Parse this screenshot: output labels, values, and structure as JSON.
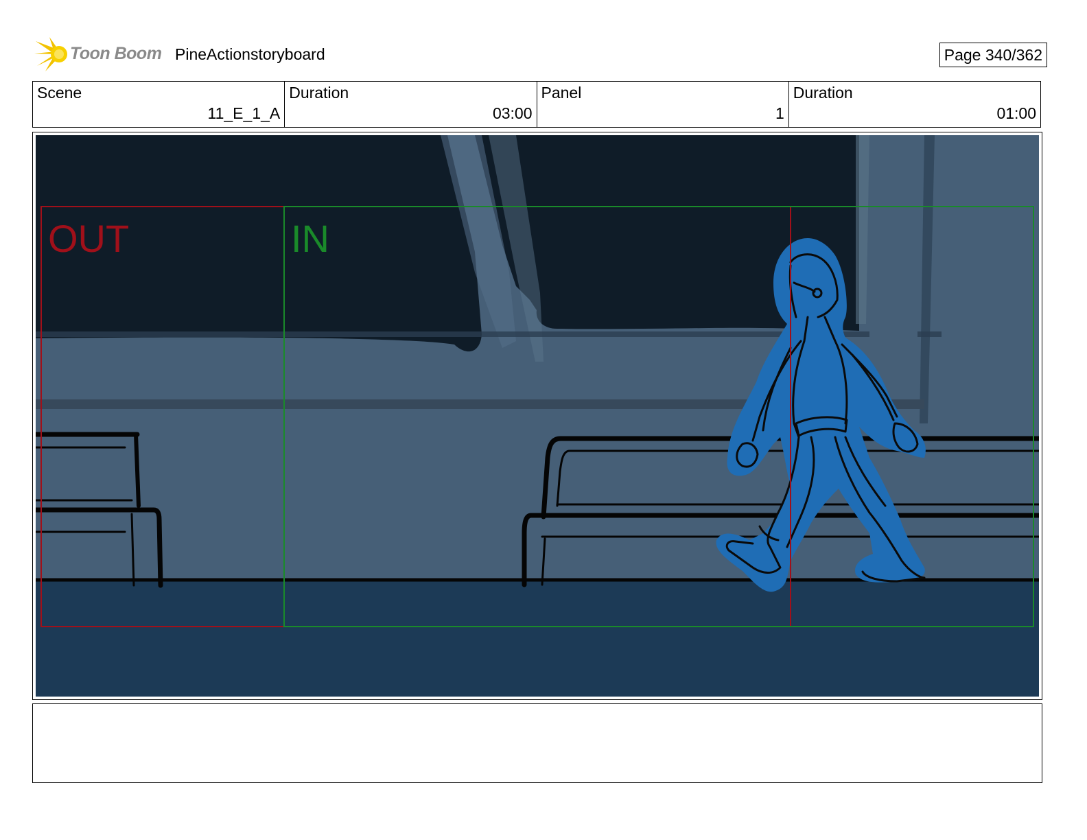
{
  "header": {
    "logo_text": "Toon Boom",
    "project_title": "PineActionstoryboard",
    "page_label": "Page 340/362"
  },
  "meta": [
    {
      "label": "Scene",
      "value": "11_E_1_A"
    },
    {
      "label": "Duration",
      "value": "03:00"
    },
    {
      "label": "Panel",
      "value": "1"
    },
    {
      "label": "Duration",
      "value": "01:00"
    }
  ],
  "panel": {
    "out_label": "OUT",
    "in_label": "IN",
    "colors": {
      "out_frame": "#a0101a",
      "in_frame": "#1a8a2a",
      "character": "#1f6db5",
      "wall": "#465f77",
      "dark_window": "#0f1c28",
      "floor": "#1c3a56"
    }
  },
  "notes": {
    "text": ""
  }
}
